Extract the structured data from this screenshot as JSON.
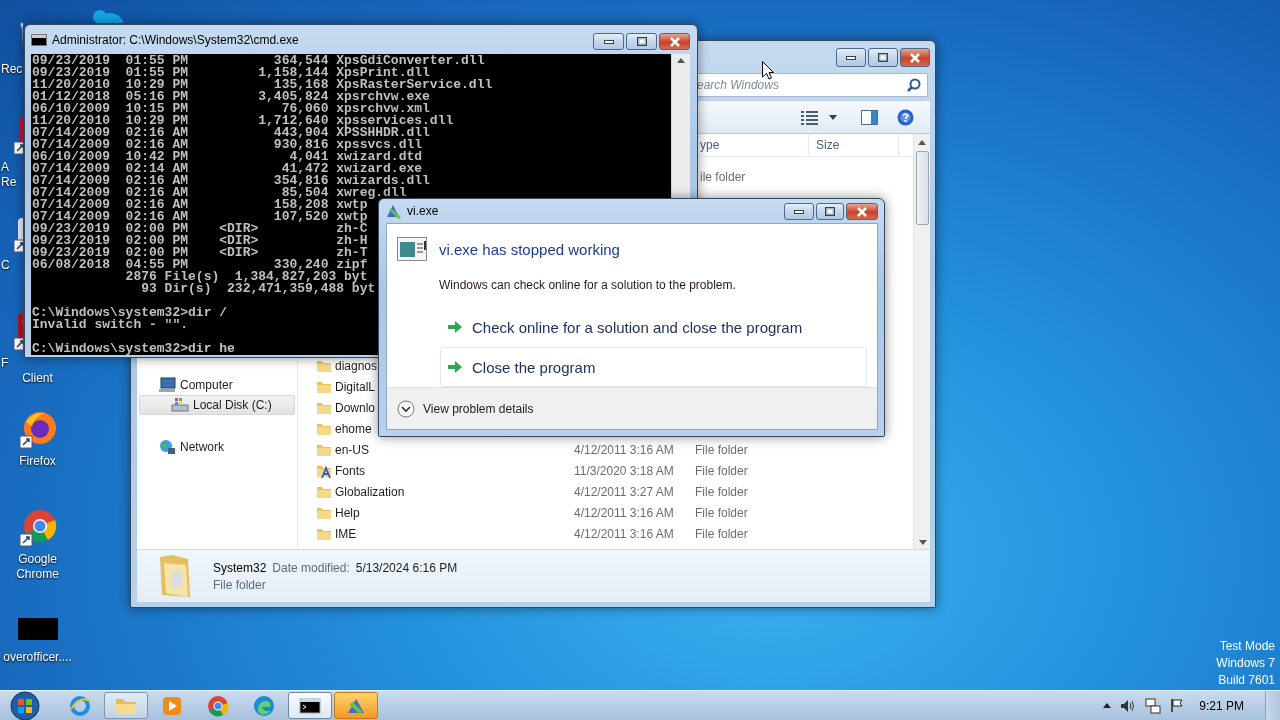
{
  "desktop": {
    "icons": [
      {
        "kind": "recycle-bin",
        "covered": true,
        "lines": [
          {
            "text": "Rec",
            "covered": true
          }
        ]
      },
      {
        "kind": "red-document",
        "covered": true,
        "lines": [
          {
            "text": "A",
            "covered": true
          },
          {
            "text": "Re",
            "covered": true
          }
        ]
      },
      {
        "kind": "app",
        "covered": true,
        "lines": [
          {
            "text": "C",
            "covered": true
          }
        ]
      },
      {
        "kind": "red-app",
        "covered": true,
        "lines": [
          {
            "text": "F",
            "covered": true
          },
          {
            "text": "Client",
            "covered": false
          }
        ]
      },
      {
        "kind": "firefox",
        "covered": false,
        "lines": [
          {
            "text": "Firefox",
            "covered": false
          }
        ]
      },
      {
        "kind": "chrome",
        "covered": false,
        "lines": [
          {
            "text": "Google",
            "covered": false
          },
          {
            "text": "Chrome",
            "covered": false
          }
        ]
      },
      {
        "kind": "black-box",
        "covered": false,
        "lines": [
          {
            "text": "overofficer....",
            "covered": false
          }
        ]
      }
    ],
    "system_lines": [
      "Test Mode",
      "Windows 7",
      "Build 7601"
    ]
  },
  "explorer": {
    "search": {
      "placeholder": "earch Windows"
    },
    "columns": [
      "ype",
      "Size"
    ],
    "top_row_type": "ile folder",
    "nav": [
      {
        "label": "Computer",
        "kind": "computer",
        "selected": false,
        "children": [
          {
            "label": "Local Disk (C:)",
            "kind": "disk",
            "selected": true
          }
        ]
      },
      {
        "label": "Network",
        "kind": "network",
        "selected": false
      }
    ],
    "rows": [
      {
        "kind": "folder",
        "name": "diagnos"
      },
      {
        "kind": "folder",
        "name": "DigitalL"
      },
      {
        "kind": "folder",
        "name": "Downlo"
      },
      {
        "kind": "folder",
        "name": "ehome"
      },
      {
        "kind": "folder",
        "name": "en-US",
        "date": "4/12/2011 3:16 AM",
        "type": "File folder"
      },
      {
        "kind": "fonts",
        "name": "Fonts",
        "date": "11/3/2020 3:18 AM",
        "type": "File folder"
      },
      {
        "kind": "folder",
        "name": "Globalization",
        "date": "4/12/2011 3:27 AM",
        "type": "File folder"
      },
      {
        "kind": "folder",
        "name": "Help",
        "date": "4/12/2011 3:16 AM",
        "type": "File folder"
      },
      {
        "kind": "folder",
        "name": "IME",
        "date": "4/12/2011 3:16 AM",
        "type": "File folder"
      }
    ],
    "details": {
      "name": "System32",
      "date_label": "Date modified:",
      "date": "5/13/2024 6:16 PM",
      "type": "File folder"
    }
  },
  "console": {
    "title": "Administrator: C:\\Windows\\System32\\cmd.exe",
    "blocks": [
      [
        "09/23/2019  01:55 PM           364,544 XpsGdiConverter.dll",
        "09/23/2019  01:55 PM         1,158,144 XpsPrint.dll",
        "11/20/2010  10:29 PM           135,168 XpsRasterService.dll",
        "01/12/2018  05:16 PM         3,405,824 xpsrchvw.exe",
        "06/10/2009  10:15 PM            76,060 xpsrchvw.xml",
        "11/20/2010  10:29 PM         1,712,640 xpsservices.dll",
        "07/14/2009  02:16 AM           443,904 XPSSHHDR.dll",
        "07/14/2009  02:16 AM           930,816 xpssvcs.dll",
        "06/10/2009  10:42 PM             4,041 xwizard.dtd",
        "07/14/2009  02:14 AM            41,472 xwizard.exe",
        "07/14/2009  02:16 AM           354,816 xwizards.dll",
        "07/14/2009  02:16 AM            85,504 xwreg.dll",
        "07/14/2009  02:16 AM           158,208 xwtp",
        "07/14/2009  02:16 AM           107,520 xwtp",
        "09/23/2019  02:00 PM    <DIR>          zh-C",
        "09/23/2019  02:00 PM    <DIR>          zh-H",
        "09/23/2019  02:00 PM    <DIR>          zh-T",
        "06/08/2018  04:55 PM           330,240 zipf",
        "            2876 File(s)  1,384,827,203 byt",
        "              93 Dir(s)  232,471,359,488 byt"
      ],
      [
        "C:\\Windows\\system32>dir /",
        "Invalid switch - \"\"."
      ],
      [
        "C:\\Windows\\system32>dir he"
      ]
    ]
  },
  "dialog": {
    "title": "vi.exe",
    "heading": "vi.exe has stopped working",
    "message": "Windows can check online for a solution to the problem.",
    "options": [
      {
        "label": "Check online for a solution and close the program",
        "focused": false
      },
      {
        "label": "Close the program",
        "focused": true
      }
    ],
    "details_link": "View problem details"
  },
  "taskbar": {
    "items": [
      {
        "kind": "ie",
        "open": false,
        "active": false,
        "flashing": false
      },
      {
        "kind": "explorer",
        "open": true,
        "active": false,
        "flashing": false
      },
      {
        "kind": "media",
        "open": false,
        "active": false,
        "flashing": false
      },
      {
        "kind": "chrome",
        "open": false,
        "active": false,
        "flashing": false
      },
      {
        "kind": "edge",
        "open": false,
        "active": false,
        "flashing": false
      },
      {
        "kind": "console",
        "open": true,
        "active": true,
        "flashing": false
      },
      {
        "kind": "vi",
        "open": true,
        "active": false,
        "flashing": true
      }
    ],
    "clock": "9:21 PM"
  }
}
